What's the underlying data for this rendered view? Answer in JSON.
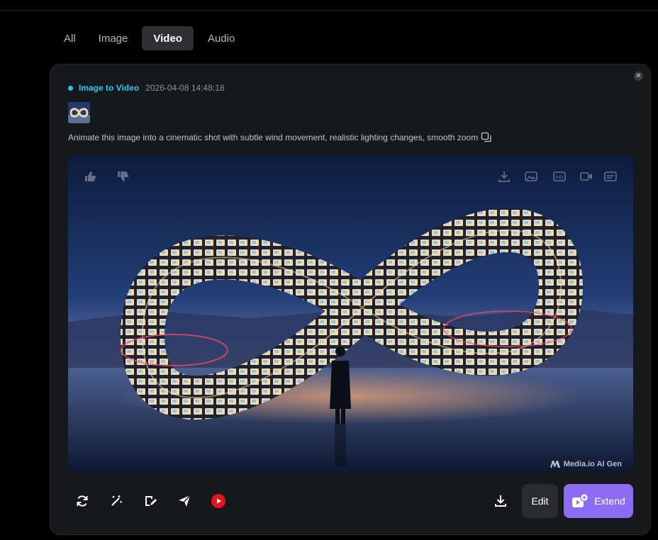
{
  "tabs": [
    {
      "label": "All",
      "active": false
    },
    {
      "label": "Image",
      "active": false
    },
    {
      "label": "Video",
      "active": true
    },
    {
      "label": "Audio",
      "active": false
    }
  ],
  "card": {
    "type_label": "Image to Video",
    "timestamp": "2026-04-08 14:48:18",
    "prompt": "Animate this image into a cinematic shot with subtle wind movement, realistic lighting changes, smooth zoom",
    "watermark": "Media.io AI Gen",
    "accent_color": "#22c6f0"
  },
  "overlay_icons": [
    "thumbs-up-icon",
    "thumbs-down-icon",
    "download-icon",
    "image-icon",
    "hd-icon",
    "video-icon",
    "caption-icon"
  ],
  "toolbar": {
    "tools": [
      "regenerate-icon",
      "magic-wand-icon",
      "edit-note-icon",
      "share-icon",
      "youtube-icon"
    ],
    "edit_label": "Edit",
    "extend_label": "Extend",
    "extend_color": "#8c6cf4"
  }
}
